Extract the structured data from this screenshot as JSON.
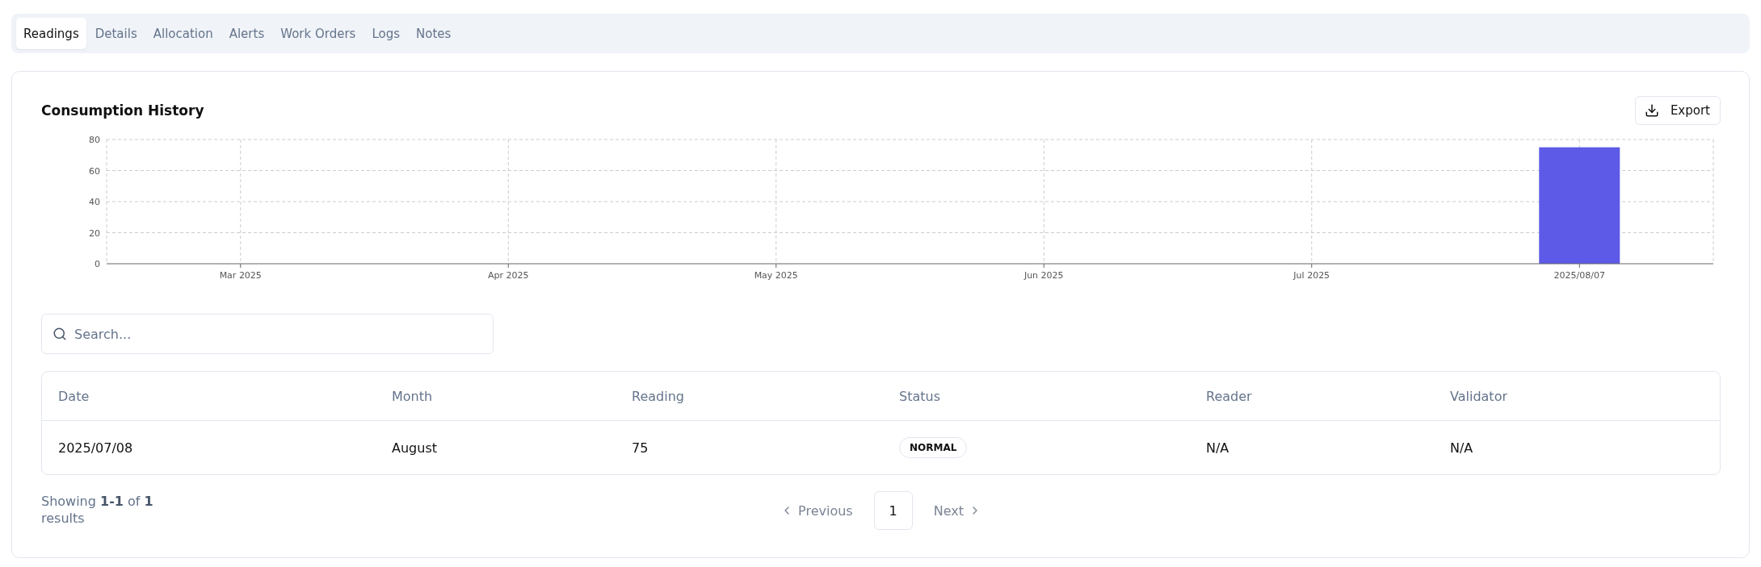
{
  "tabs": [
    {
      "label": "Readings",
      "selected": true
    },
    {
      "label": "Details",
      "selected": false
    },
    {
      "label": "Allocation",
      "selected": false
    },
    {
      "label": "Alerts",
      "selected": false
    },
    {
      "label": "Work Orders",
      "selected": false
    },
    {
      "label": "Logs",
      "selected": false
    },
    {
      "label": "Notes",
      "selected": false
    }
  ],
  "card": {
    "title": "Consumption History",
    "export_button": "Export",
    "chart_data": {
      "type": "bar",
      "categories": [
        "Mar 2025",
        "Apr 2025",
        "May 2025",
        "Jun 2025",
        "Jul 2025",
        "2025/08/07"
      ],
      "series": [
        {
          "color": "#5e5ae8",
          "values": [
            null,
            null,
            null,
            null,
            null,
            75
          ]
        }
      ],
      "ylim": [
        0,
        80
      ],
      "yticks": [
        0,
        20,
        40,
        60,
        80
      ],
      "grid": true
    },
    "search": {
      "placeholder": "Search..."
    },
    "table": {
      "columns": [
        "Date",
        "Month",
        "Reading",
        "Status",
        "Reader",
        "Validator"
      ],
      "rows": [
        {
          "date": "2025/07/08",
          "month": "August",
          "reading": "75",
          "status": "NORMAL",
          "reader": "N/A",
          "validator": "N/A"
        }
      ]
    },
    "footer": {
      "summary": "Showing **1-1** of **1** results",
      "previous": "Previous",
      "pages": [
        {
          "label": "1",
          "selected": true
        }
      ],
      "next": "Next"
    }
  }
}
